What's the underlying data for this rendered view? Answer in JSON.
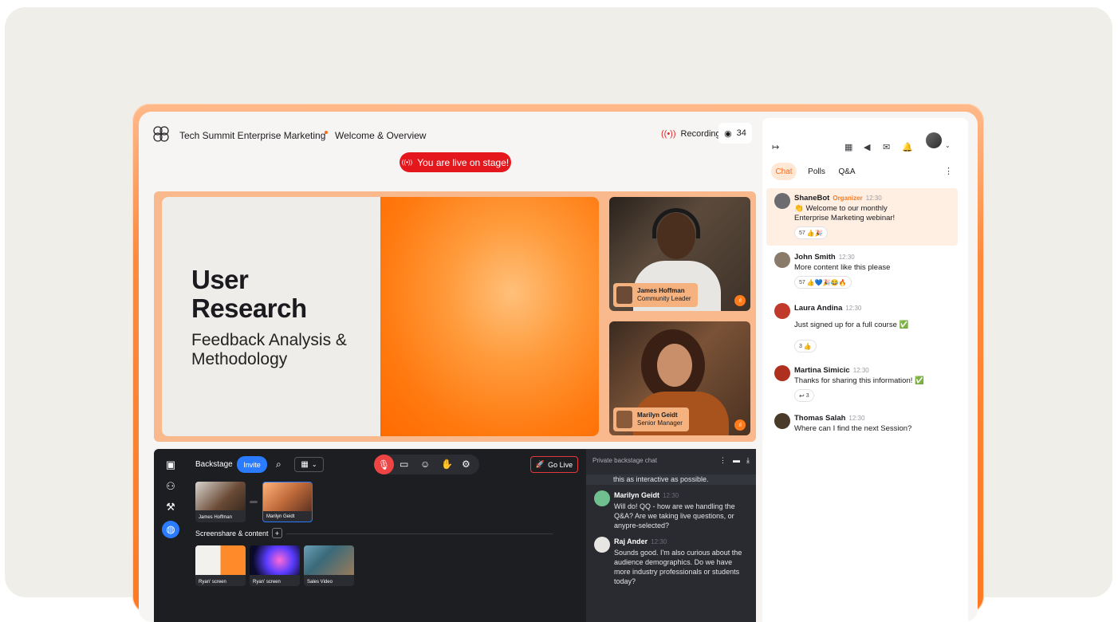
{
  "header": {
    "event_title": "Tech Summit Enterprise Marketing",
    "session_title": "Welcome & Overview",
    "recording_label": "Recording",
    "viewer_count": "34",
    "live_banner": "You are live on stage!"
  },
  "stage": {
    "slide_title": "User Research",
    "slide_subtitle": "Feedback Analysis & Methodology",
    "speakers": [
      {
        "name": "James Hoffman",
        "role": "Community Leader"
      },
      {
        "name": "Marilyn Geidt",
        "role": "Senior Manager"
      }
    ]
  },
  "backstage": {
    "title": "Backstage",
    "invite_label": "Invite",
    "go_live_label": "Go Live",
    "participants": [
      {
        "name": "James Hoffman"
      },
      {
        "name": "Marilyn Geidt"
      }
    ],
    "screenshare_title": "Screenshare & content",
    "content_items": [
      {
        "label": "Ryan' screen"
      },
      {
        "label": "Ryan' screen"
      },
      {
        "label": "Sales Video"
      }
    ],
    "private_chat": {
      "title": "Private backstage chat",
      "continued_text": "this as interactive as possible.",
      "messages": [
        {
          "author": "Marilyn Geidt",
          "time": "12:30",
          "text": "Will do! QQ - how are we handling the Q&A? Are we taking live questions, or anypre-selected?"
        },
        {
          "author": "Raj Ander",
          "time": "12:30",
          "text": "Sounds good. I'm also curious about the audience demographics. Do we have more industry professionals or students today?"
        }
      ]
    }
  },
  "chat_panel": {
    "tabs": [
      "Chat",
      "Polls",
      "Q&A"
    ],
    "active_tab": "Chat",
    "messages": [
      {
        "author": "ShaneBot",
        "badge": "Organizer",
        "time": "12:30",
        "text": "👏 Welcome to our monthly Enterprise Marketing webinar!",
        "reactions": "57",
        "reaction_emojis": "👍🎉"
      },
      {
        "author": "John Smith",
        "time": "12:30",
        "text": "More content like this please",
        "reactions": "57",
        "reaction_emojis": "👍💙🎉😂🔥"
      },
      {
        "author": "Laura Andina",
        "time": "12:30",
        "text": "Just signed up for a full course ✅",
        "reactions": "3",
        "reaction_emojis": "👍"
      },
      {
        "author": "Martina Simicic",
        "time": "12:30",
        "text": "Thanks for sharing this information! ✅",
        "reactions": "3",
        "reaction_emojis": "↩"
      },
      {
        "author": "Thomas Salah",
        "time": "12:30",
        "text": "Where can I find the next Session?"
      }
    ]
  },
  "colors": {
    "accent": "#ff6a1a",
    "live_red": "#e4171d",
    "primary_blue": "#2a7bff",
    "dark_bg": "#1d1e22"
  }
}
